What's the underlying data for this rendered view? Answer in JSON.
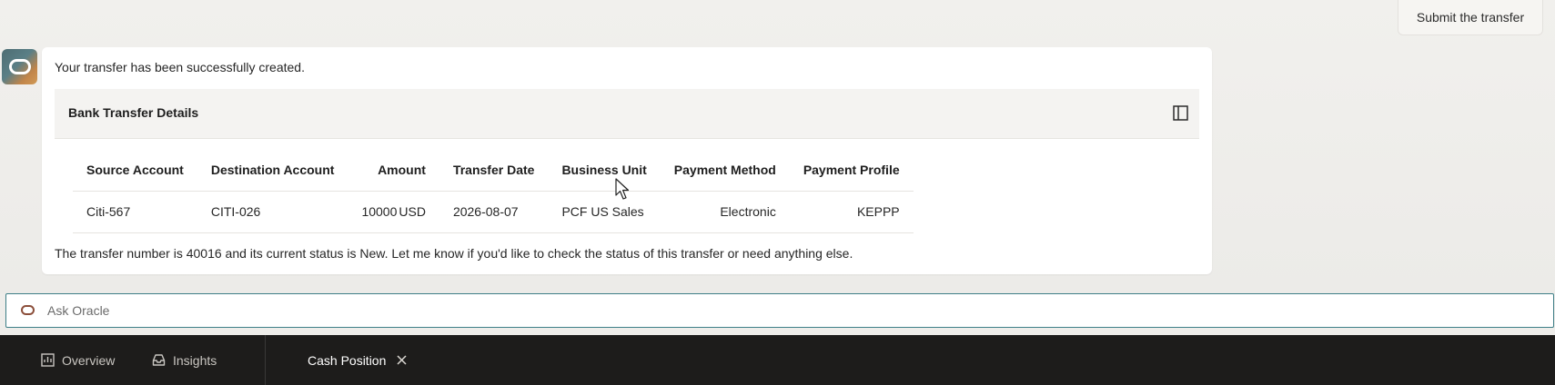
{
  "user_message": "Submit the transfer",
  "bot": {
    "intro": "Your transfer has been successfully created.",
    "panel_title": "Bank Transfer Details",
    "table": {
      "headers": [
        "Source Account",
        "Destination Account",
        "Amount",
        "Transfer Date",
        "Business Unit",
        "Payment Method",
        "Payment Profile"
      ],
      "row": {
        "source": "Citi-567",
        "destination": "CITI-026",
        "amount": "10000",
        "currency": "USD",
        "date": "2026-08-07",
        "business_unit": "PCF US Sales",
        "payment_method": "Electronic",
        "payment_profile": "KEPPP"
      }
    },
    "outro": "The transfer number is 40016 and its current status is New. Let me know if you'd like to check the status of this transfer or need anything else."
  },
  "ask": {
    "placeholder": "Ask Oracle"
  },
  "tabs": {
    "overview": "Overview",
    "insights": "Insights",
    "cash_position": "Cash Position"
  },
  "colors": {
    "accent_border": "#3e7f87",
    "tabbar_bg": "#1d1c1b",
    "oracle_icon": "#8c4f3b"
  }
}
